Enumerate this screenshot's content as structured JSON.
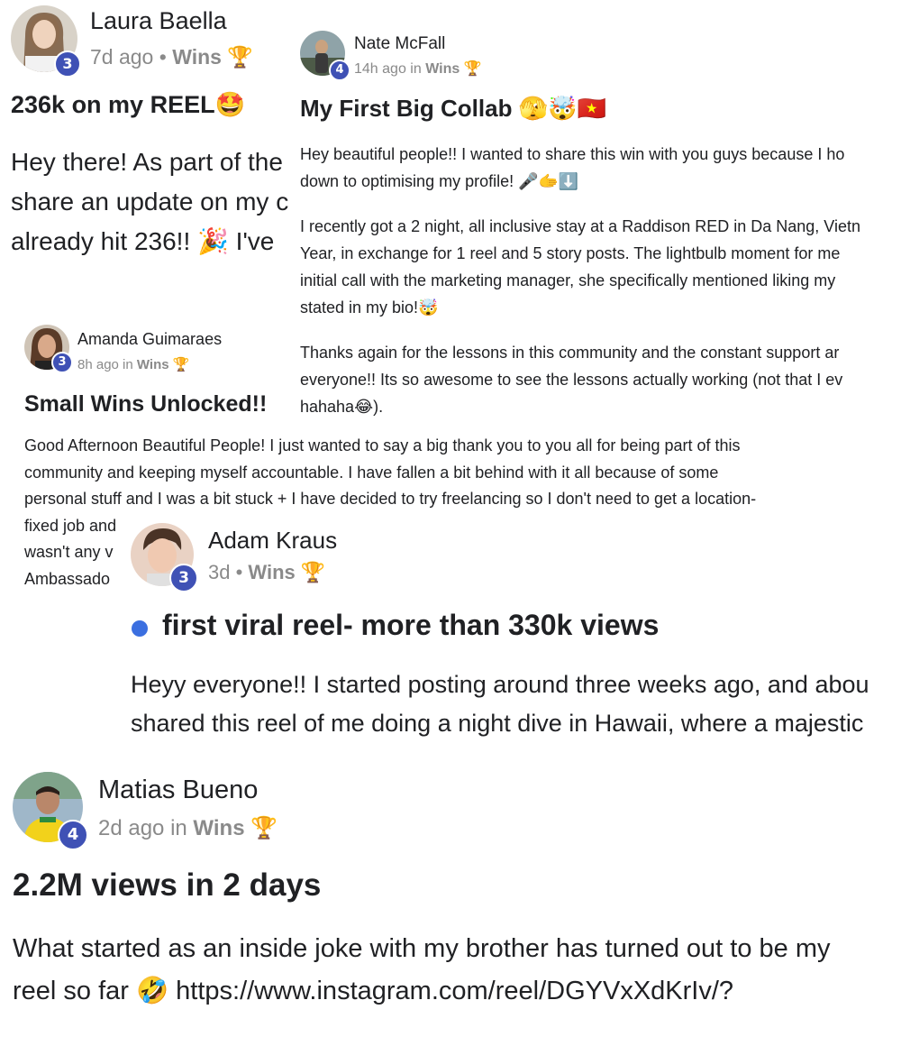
{
  "posts": {
    "laura": {
      "author": "Laura Baella",
      "level": "3",
      "time": "7d ago",
      "sep": " • ",
      "category": "Wins",
      "trophy": "🏆",
      "title": "236k on my REEL",
      "title_emoji": "🤩",
      "lines": [
        "Hey there! As part of the",
        "share an update on my c",
        "already hit 236!! 🎉 I've"
      ]
    },
    "nate": {
      "author": "Nate McFall",
      "level": "4",
      "time": "14h ago",
      "in_word": " in ",
      "category": "Wins",
      "trophy": "🏆",
      "title": "My First Big Collab",
      "title_emoji": "🫣🤯🇻🇳",
      "lines": [
        "Hey beautiful people!! I wanted to share this win with you guys because I ho",
        "down to optimising my profile! 🎤🫱⬇️",
        "I recently got a 2 night, all inclusive stay at a Raddison RED in Da Nang, Vietn",
        "Year, in exchange for 1 reel and 5 story posts. The lightbulb moment for me",
        "initial call with the marketing manager, she specifically mentioned liking my",
        "stated in my bio!🤯",
        "Thanks again for the lessons in this community and the constant support ar",
        "everyone!! Its so awesome to see the lessons actually working (not that I ev",
        "hahaha😂)."
      ]
    },
    "amanda": {
      "author": "Amanda Guimaraes",
      "level": "3",
      "time": "8h ago",
      "in_word": " in ",
      "category": "Wins",
      "trophy": "🏆",
      "title": "Small Wins Unlocked!!",
      "lines": [
        "Good Afternoon Beautiful People! I just wanted to say a big thank you to you all for being part of this",
        "community and keeping myself accountable. I have fallen a bit behind with it all because of some",
        "personal stuff and I was a bit stuck + I have decided to try freelancing so I don't need to get a location-",
        "fixed job and",
        "wasn't any v",
        "Ambassado"
      ]
    },
    "adam": {
      "author": "Adam Kraus",
      "level": "3",
      "time": "3d",
      "sep": " • ",
      "category": "Wins",
      "trophy": "🏆",
      "title": "first viral reel- more than 330k views",
      "lines": [
        "Heyy everyone!! I started posting around three weeks ago, and abou",
        "shared this reel of me doing a night dive in Hawaii, where a majestic"
      ]
    },
    "matias": {
      "author": "Matias Bueno",
      "level": "4",
      "time": "2d ago",
      "in_word": " in ",
      "category": "Wins",
      "trophy": "🏆",
      "title": "2.2M views in 2 days",
      "lines": [
        "What started as an inside joke with my brother has turned out to be my",
        "reel so far 🤣 https://www.instagram.com/reel/DGYVxXdKrIv/?"
      ]
    }
  }
}
